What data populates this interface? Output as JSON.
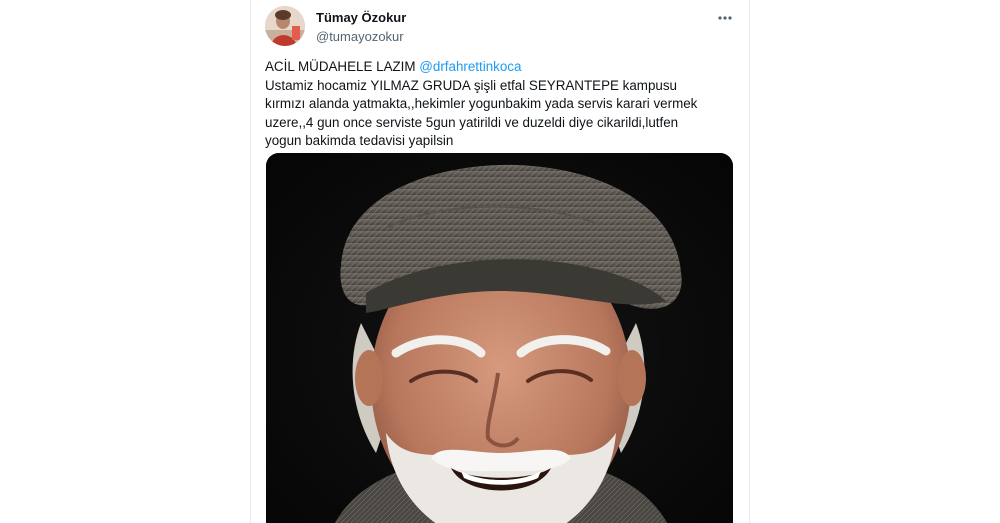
{
  "tweet": {
    "author": {
      "display_name": "Tümay Özokur",
      "handle": "@tumayozokur"
    },
    "more_icon": "more-horizontal-icon",
    "text_lines": [
      {
        "before": "ACİL MÜDAHELE LAZIM ",
        "mention": "@drfahrettinkoca"
      },
      {
        "text": "Ustamiz hocamiz YILMAZ GRUDA şişli etfal SEYRANTEPE kampusu"
      },
      {
        "text": "kırmızı alanda yatmakta,,hekimler yogunbakim yada servis karari vermek"
      },
      {
        "text": "uzere,,4 gun once serviste 5gun yatirildi ve duzeldi diye cikarildi,lutfen"
      },
      {
        "text": "yogun bakimda tedavisi yapilsin"
      }
    ],
    "media": {
      "type": "photo",
      "subject": "portrait-photo"
    }
  },
  "colors": {
    "text": "#0f1419",
    "secondary": "#536471",
    "link": "#1d9bf0",
    "photo_background": "#070707"
  }
}
